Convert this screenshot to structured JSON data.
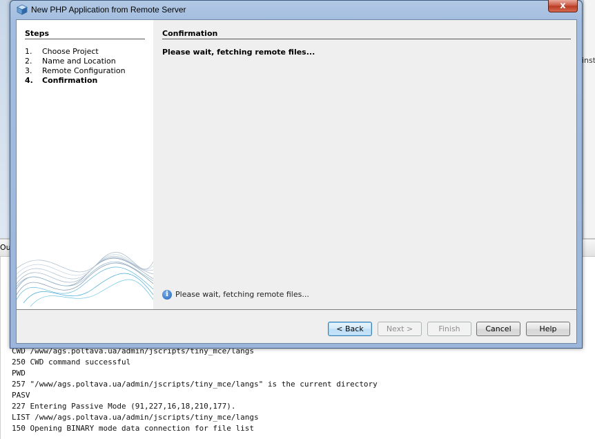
{
  "background": {
    "right_edge_text": "inst",
    "output_tab_label": "Ou",
    "log_lines": [
      "CWD /www/ags.poltava.ua/admin/jscripts/tiny_mce/langs",
      "250 CWD command successful",
      "PWD",
      "257 \"/www/ags.poltava.ua/admin/jscripts/tiny_mce/langs\" is the current directory",
      "PASV",
      "227 Entering Passive Mode (91,227,16,18,210,177).",
      "LIST /www/ags.poltava.ua/admin/jscripts/tiny_mce/langs",
      "150 Opening BINARY mode data connection for file list"
    ]
  },
  "dialog": {
    "title": "New PHP Application from Remote Server",
    "close_label": "x",
    "steps_heading": "Steps",
    "steps": [
      {
        "num": "1.",
        "label": "Choose Project"
      },
      {
        "num": "2.",
        "label": "Name and Location"
      },
      {
        "num": "3.",
        "label": "Remote Configuration"
      },
      {
        "num": "4.",
        "label": "Confirmation"
      }
    ],
    "active_step": 4,
    "content_heading": "Confirmation",
    "content_message": "Please wait, fetching remote files...",
    "info_icon_glyph": "i",
    "status_message": "Please wait, fetching remote files...",
    "buttons": {
      "back": "< Back",
      "next": "Next >",
      "finish": "Finish",
      "cancel": "Cancel",
      "help": "Help"
    }
  }
}
